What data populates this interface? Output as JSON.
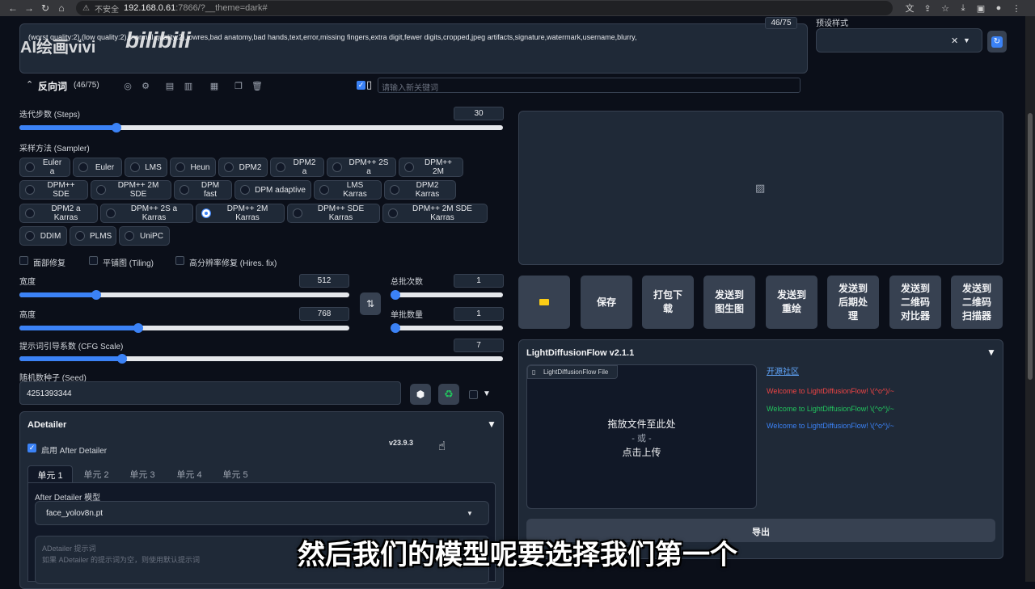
{
  "browser": {
    "security_label": "不安全",
    "url_host": "192.168.0.61",
    "url_path": ":7866/?__theme=dark#"
  },
  "prompt": {
    "watermark_text": "AI绘画vivi",
    "watermark_logo": "bilibili",
    "negative_text": "(worst quality:2),(low quality:2),(normal quality:2),lowres,bad anatomy,bad hands,text,error,missing fingers,extra digit,fewer digits,cropped,jpeg artifacts,signature,watermark,username,blurry,",
    "counter": "46/75",
    "negative_label": "反向词",
    "negative_count": "(46/75)",
    "keyword_placeholder": "请输入新关键词",
    "style_label": "预设样式"
  },
  "params": {
    "steps_label": "迭代步数 (Steps)",
    "steps_value": "30",
    "steps_level": 0.2,
    "sampler_label": "采样方法 (Sampler)",
    "samplers_row1": [
      "Euler a",
      "Euler",
      "LMS",
      "Heun",
      "DPM2",
      "DPM2 a",
      "DPM++ 2S a",
      "DPM++ 2M"
    ],
    "samplers_row2": [
      "DPM++ SDE",
      "DPM++ 2M SDE",
      "DPM fast",
      "DPM adaptive",
      "LMS Karras",
      "DPM2 Karras"
    ],
    "samplers_row3": [
      "DPM2 a Karras",
      "DPM++ 2S a Karras",
      "DPM++ 2M Karras",
      "DPM++ SDE Karras",
      "DPM++ 2M SDE Karras"
    ],
    "samplers_row4": [
      "DDIM",
      "PLMS",
      "UniPC"
    ],
    "selected_sampler": "DPM++ 2M Karras",
    "face_restore_label": "面部修复",
    "tiling_label": "平铺图 (Tiling)",
    "hires_label": "高分辨率修复 (Hires. fix)",
    "width_label": "宽度",
    "width_value": "512",
    "width_level": 0.23,
    "height_label": "高度",
    "height_value": "768",
    "height_level": 0.36,
    "batch_count_label": "总批次数",
    "batch_count_value": "1",
    "batch_size_label": "单批数量",
    "batch_size_value": "1",
    "cfg_label": "提示词引导系数 (CFG Scale)",
    "cfg_value": "7",
    "cfg_level": 0.21,
    "seed_label": "随机数种子 (Seed)",
    "seed_value": "4251393344"
  },
  "adetailer": {
    "title": "ADetailer",
    "enable_label": "启用 After Detailer",
    "version": "v23.9.3",
    "tabs": [
      "单元 1",
      "单元 2",
      "单元 3",
      "单元 4",
      "单元 5"
    ],
    "model_label": "After Detailer 模型",
    "model_value": "face_yolov8n.pt",
    "prompt_placeholder_1": "ADetailer 提示词",
    "prompt_placeholder_2": "如果 ADetailer 的提示词为空，则使用默认提示词"
  },
  "output_buttons": {
    "folder_icon": "folder-icon",
    "save": "保存",
    "zip": "打包下载",
    "to_img2img": "发送到图生图",
    "to_inpaint": "发送到重绘",
    "to_extras": "发送到后期处理",
    "to_qr_compare": "发送到二维码对比器",
    "to_qr_scanner": "发送到二维码扫描器"
  },
  "flow": {
    "title": "LightDiffusionFlow v2.1.1",
    "file_label": "LightDiffusionFlow File",
    "drop_text": "拖放文件至此处",
    "or_text": "- 或 -",
    "upload_text": "点击上传",
    "community_link": "开源社区",
    "welcome_red": "Welcome to LightDiffusionFlow! \\(^o^)/~",
    "welcome_green": "Welcome to LightDiffusionFlow! \\(^o^)/~",
    "welcome_blue": "Welcome to LightDiffusionFlow! \\(^o^)/~",
    "export_label": "导出"
  },
  "subtitle": "然后我们的模型呢要选择我们第一个",
  "colors": {
    "accent": "#3b82f6",
    "red": "#ef4444",
    "green": "#22c55e",
    "blue": "#3b82f6",
    "recycle_green": "#22c55e"
  }
}
